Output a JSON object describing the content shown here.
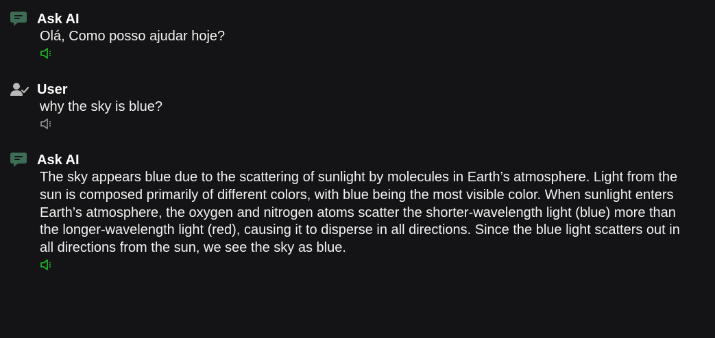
{
  "colors": {
    "background": "#141416",
    "ai_icon": "#3d6e55",
    "user_icon": "#b9b9b9",
    "speaker_active": "#22c32a",
    "speaker_inactive": "#9a9a9a"
  },
  "messages": [
    {
      "sender": "Ask AI",
      "role": "ai",
      "icon": "chat-bubble-icon",
      "text": "Olá, Como posso ajudar hoje?",
      "speaker_state": "active"
    },
    {
      "sender": "User",
      "role": "user",
      "icon": "user-check-icon",
      "text": "why the sky is blue?",
      "speaker_state": "inactive"
    },
    {
      "sender": "Ask AI",
      "role": "ai",
      "icon": "chat-bubble-icon",
      "text": "The sky appears blue due to the scattering of sunlight by molecules in Earth’s atmosphere. Light from the sun is composed primarily of different colors, with blue being the most visible color. When sunlight enters Earth’s atmosphere, the oxygen and nitrogen atoms scatter the shorter-wavelength light (blue) more than the longer-wavelength light (red), causing it to disperse in all directions. Since the blue light scatters out in all directions from the sun, we see the sky as blue.",
      "speaker_state": "active"
    }
  ]
}
